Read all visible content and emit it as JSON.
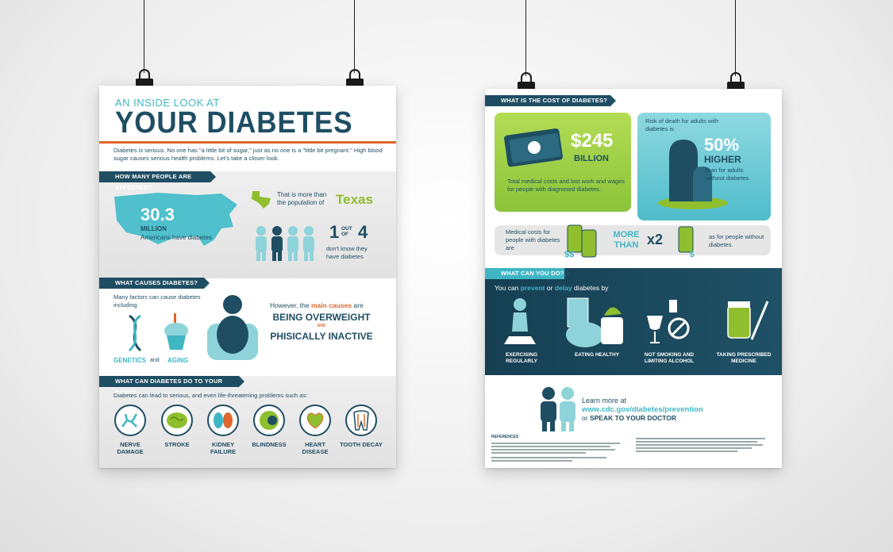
{
  "left_poster": {
    "title_small": "AN INSIDE LOOK AT",
    "title_big": "YOUR DIABETES",
    "intro": "Diabetes is serious. No one has \"a little bit of sugar,\" just as no one is a \"little bit pregnant.\" High blood sugar causes serious health problems. Let's take a closer look.",
    "section1": {
      "heading": "HOW MANY PEOPLE ARE AFFECTED?",
      "number": "30.3",
      "million": "MILLION",
      "americans": "Americans have diabetes",
      "more_than": "That is more than the population of",
      "texas": "Texas",
      "one": "1",
      "out_of": "OUT OF",
      "four": "4",
      "dont_know": "don't know they have diabetes"
    },
    "section2": {
      "heading": "WHAT CAUSES DIABETES?",
      "factors": "Many factors can cause diabetes including",
      "genetics": "GENETICS",
      "and": "and",
      "aging": "AGING",
      "however": "However, the",
      "main_causes": "main causes",
      "are": "are",
      "overweight": "BEING OVERWEIGHT",
      "and_caps": "AND",
      "inactive": "PHISICALLY INACTIVE"
    },
    "section3": {
      "heading": "WHAT CAN DIABETES DO TO YOUR BODY?",
      "lead": "Diabetes can lead to serious, and even life-threatening problems such as:",
      "items": [
        {
          "label": "NERVE DAMAGE",
          "icon": "nerve-icon"
        },
        {
          "label": "STROKE",
          "icon": "brain-icon"
        },
        {
          "label": "KIDNEY FAILURE",
          "icon": "kidney-icon"
        },
        {
          "label": "BLINDNESS",
          "icon": "eye-icon"
        },
        {
          "label": "HEART DISEASE",
          "icon": "heart-icon"
        },
        {
          "label": "TOOTH DECAY",
          "icon": "tooth-icon"
        }
      ]
    }
  },
  "right_poster": {
    "cost_heading": "WHAT IS THE COST OF DIABETES?",
    "cost_amount": "$245",
    "cost_billion": "BILLION",
    "cost_desc": "Total medical costs and lost work and wages for people with diagnosed diabetes.",
    "risk_intro": "Risk of death for adults with diabetes is",
    "risk_pct": "50%",
    "risk_higher": "HIGHER",
    "risk_than": "than for adults without diabetes.",
    "med_costs": "Medical costs for people with diabetes are",
    "more_than": "MORE THAN",
    "x2": "x2",
    "as_for": "as for people without diabetes.",
    "do_heading": "WHAT CAN YOU DO?",
    "prevent_pre": "You can",
    "prevent": "prevent",
    "or": "or",
    "delay": "delay",
    "prevent_post": "diabetes by",
    "actions": [
      {
        "label": "EXERCISING REGULARLY"
      },
      {
        "label": "EATING HEALTHY"
      },
      {
        "label": "NOT SMOKING AND LIMITING ALCOHOL"
      },
      {
        "label": "TAKING PRESCRIBED MEDICINE"
      }
    ],
    "learn_more": "Learn more at",
    "url": "www.cdc.gov/diabetes/prevention",
    "or_speak_pre": "or",
    "speak": "SPEAK TO YOUR DOCTOR",
    "references": "REFERENCES",
    "colors": {
      "navy": "#1f4e63",
      "teal": "#3fb6c4",
      "lime": "#9ccc3c",
      "orange": "#e0662b"
    }
  }
}
